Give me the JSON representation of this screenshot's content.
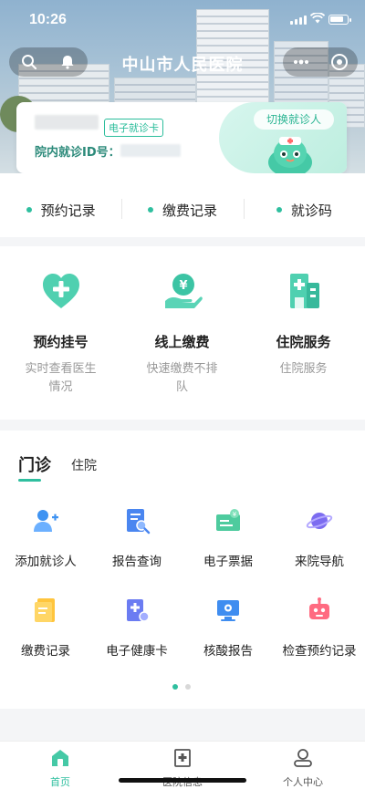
{
  "status_bar": {
    "time": "10:26"
  },
  "nav": {
    "title": "中山市人民医院"
  },
  "patient_card": {
    "badge": "电子就诊卡",
    "id_label": "院内就诊ID号：",
    "switch_label": "切换就诊人"
  },
  "quick_links": [
    {
      "label": "预约记录"
    },
    {
      "label": "缴费记录"
    },
    {
      "label": "就诊码"
    }
  ],
  "services": [
    {
      "title": "预约挂号",
      "subtitle": "实时查看医生情况",
      "icon": "heart-plus-icon"
    },
    {
      "title": "线上缴费",
      "subtitle": "快速缴费不排队",
      "icon": "yuan-hand-icon"
    },
    {
      "title": "住院服务",
      "subtitle": "住院服务",
      "icon": "hospital-building-icon"
    }
  ],
  "tabs": {
    "active": "门诊",
    "inactive": "住院"
  },
  "grid_items": [
    {
      "label": "添加就诊人",
      "icon": "add-person-icon"
    },
    {
      "label": "报告查询",
      "icon": "report-search-icon"
    },
    {
      "label": "电子票据",
      "icon": "e-receipt-icon"
    },
    {
      "label": "来院导航",
      "icon": "navigation-planet-icon"
    },
    {
      "label": "缴费记录",
      "icon": "payment-record-icon"
    },
    {
      "label": "电子健康卡",
      "icon": "health-card-icon"
    },
    {
      "label": "核酸报告",
      "icon": "nucleic-report-icon"
    },
    {
      "label": "检查预约记录",
      "icon": "robot-icon"
    }
  ],
  "tabbar": [
    {
      "label": "首页",
      "icon": "home-icon",
      "active": true
    },
    {
      "label": "医院信息",
      "icon": "hospital-info-icon",
      "active": false
    },
    {
      "label": "个人中心",
      "icon": "user-center-icon",
      "active": false
    }
  ],
  "colors": {
    "accent": "#2fbf9f",
    "text": "#222222",
    "muted": "#999999"
  }
}
